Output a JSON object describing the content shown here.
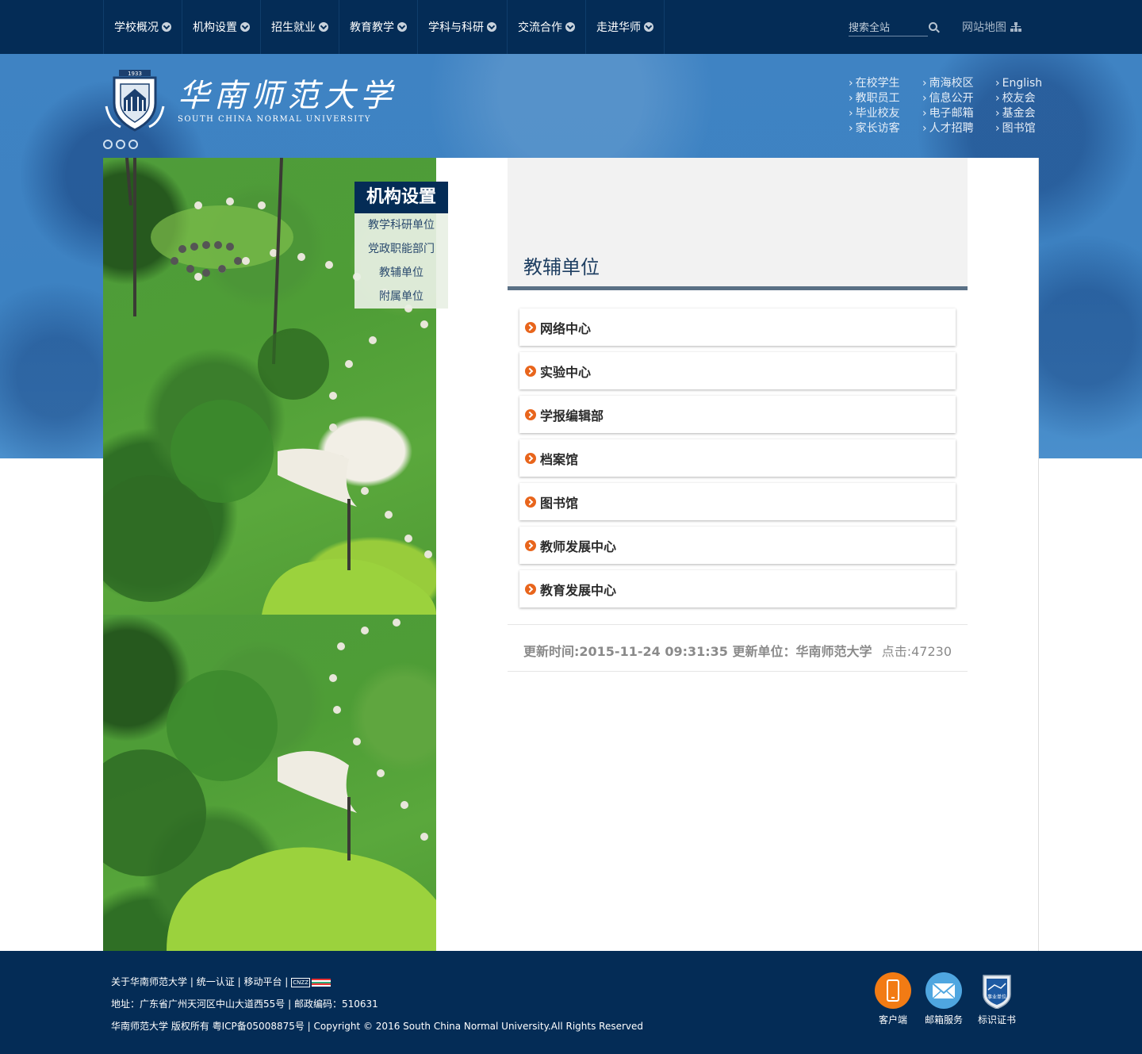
{
  "nav": {
    "items": [
      {
        "label": "学校概况"
      },
      {
        "label": "机构设置"
      },
      {
        "label": "招生就业"
      },
      {
        "label": "教育教学"
      },
      {
        "label": "学科与科研"
      },
      {
        "label": "交流合作"
      },
      {
        "label": "走进华师"
      }
    ],
    "search_placeholder": "搜索全站",
    "sitemap_label": "网站地图"
  },
  "banner": {
    "logo_year": "1933",
    "logo_cn": "华南师范大学",
    "logo_en": "SOUTH CHINA NORMAL UNIVERSITY",
    "quick_links": [
      {
        "label": "在校学生"
      },
      {
        "label": "南海校区"
      },
      {
        "label": "English"
      },
      {
        "label": "教职员工"
      },
      {
        "label": "信息公开"
      },
      {
        "label": "校友会"
      },
      {
        "label": "毕业校友"
      },
      {
        "label": "电子邮箱"
      },
      {
        "label": "基金会"
      },
      {
        "label": "家长访客"
      },
      {
        "label": "人才招聘"
      },
      {
        "label": "图书馆"
      }
    ]
  },
  "subnav": {
    "title": "机构设置",
    "items": [
      {
        "label": "教学科研单位"
      },
      {
        "label": "党政职能部门"
      },
      {
        "label": "教辅单位"
      },
      {
        "label": "附属单位"
      }
    ]
  },
  "main": {
    "title": "教辅单位",
    "list": [
      {
        "label": "网络中心"
      },
      {
        "label": "实验中心"
      },
      {
        "label": "学报编辑部"
      },
      {
        "label": "档案馆"
      },
      {
        "label": "图书馆"
      },
      {
        "label": "教师发展中心"
      },
      {
        "label": "教育发展中心"
      }
    ],
    "meta_update": "更新时间:2015-11-24 09:31:35  更新单位：华南师范大学",
    "meta_clicks": "点击:47230"
  },
  "footer": {
    "links": [
      "关于华南师范大学",
      "统一认证",
      "移动平台"
    ],
    "separator": "|",
    "cnzz": "CNZZ",
    "address": "地址：广东省广州天河区中山大道西55号 | 邮政编码：510631",
    "copyright": "华南师范大学 版权所有 粤ICP备05008875号 | Copyright © 2016 South China Normal University.All Rights Reserved",
    "icons": [
      {
        "label": "客户端",
        "icon": "mobile-icon"
      },
      {
        "label": "邮箱服务",
        "icon": "mail-icon"
      },
      {
        "label": "标识证书",
        "icon": "badge-icon",
        "badge_text": "事业单位"
      }
    ]
  },
  "colors": {
    "navy": "#042c56",
    "banner_blue": "#3f83c3",
    "accent_orange": "#e8651c",
    "rule": "#5a7085"
  }
}
